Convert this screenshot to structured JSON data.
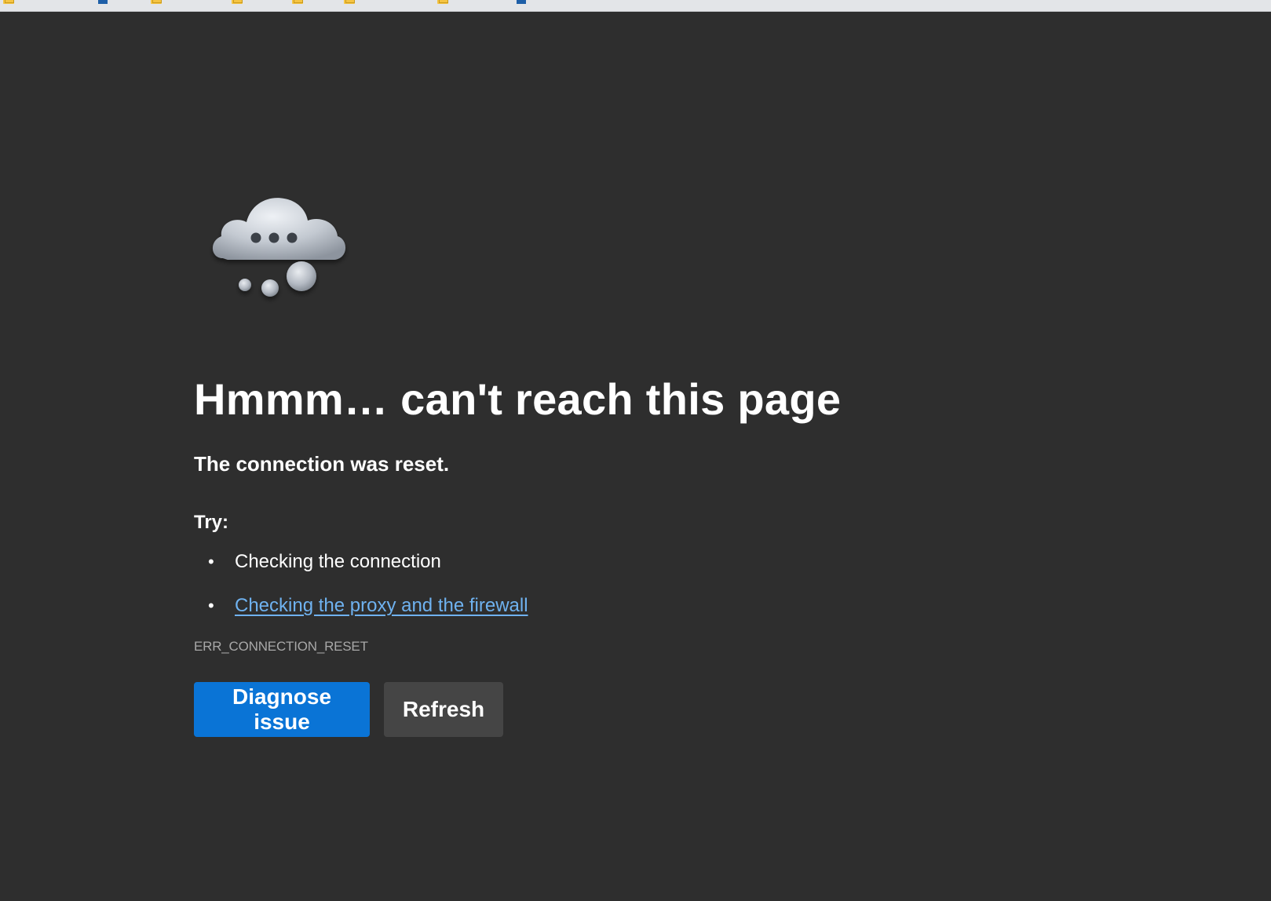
{
  "error": {
    "title": "Hmmm… can't reach this page",
    "subtitle": "The connection was reset.",
    "try_label": "Try:",
    "suggestions": [
      {
        "text": "Checking the connection",
        "is_link": false
      },
      {
        "text": "Checking the proxy and the firewall",
        "is_link": true
      }
    ],
    "code": "ERR_CONNECTION_RESET"
  },
  "buttons": {
    "diagnose_label": "Diagnose issue",
    "refresh_label": "Refresh"
  },
  "illustration": {
    "icon": "thinking-cloud-icon"
  },
  "colors": {
    "page_background": "#2e2e2e",
    "primary_button": "#0a74d6",
    "secondary_button": "#454545",
    "link": "#6fb2f0",
    "error_code_text": "#a8a8a8"
  }
}
